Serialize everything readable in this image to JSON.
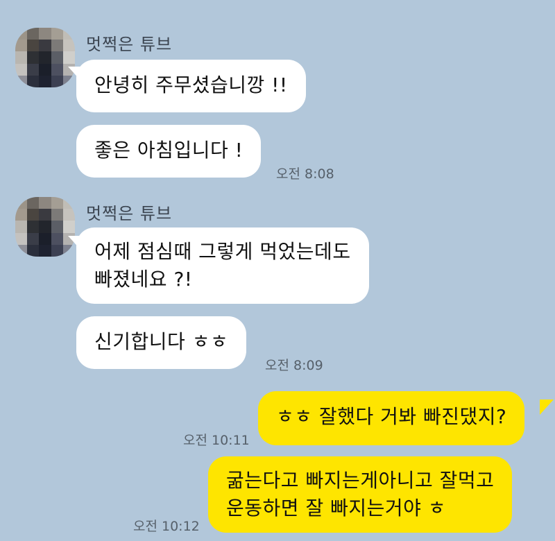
{
  "chat": {
    "groups": [
      {
        "sender": "멋쩍은 튜브",
        "messages": [
          {
            "lines": [
              "안녕히 주무셨습니깡 !!"
            ]
          },
          {
            "lines": [
              "좋은 아침입니다 !"
            ],
            "time": "오전 8:08"
          }
        ]
      },
      {
        "sender": "멋쩍은 튜브",
        "messages": [
          {
            "lines": [
              "어제 점심때 그렇게 먹었는데도",
              "빠졌네요 ?!"
            ]
          },
          {
            "lines": [
              "신기합니다 ㅎㅎ"
            ],
            "time": "오전 8:09"
          }
        ]
      }
    ],
    "outgoing": [
      {
        "lines": [
          "ㅎㅎ 잘했다 거봐 빠진댔지?"
        ],
        "time": "오전 10:11"
      },
      {
        "lines": [
          "굶는다고 빠지는게아니고 잘먹고",
          "운동하면 잘 빠지는거야 ㅎ"
        ],
        "time": "오전 10:12"
      }
    ],
    "colors": {
      "background": "#b2c7da",
      "incoming_bubble": "#ffffff",
      "outgoing_bubble": "#fee500"
    },
    "avatar_icon": "blurred-profile-photo"
  }
}
